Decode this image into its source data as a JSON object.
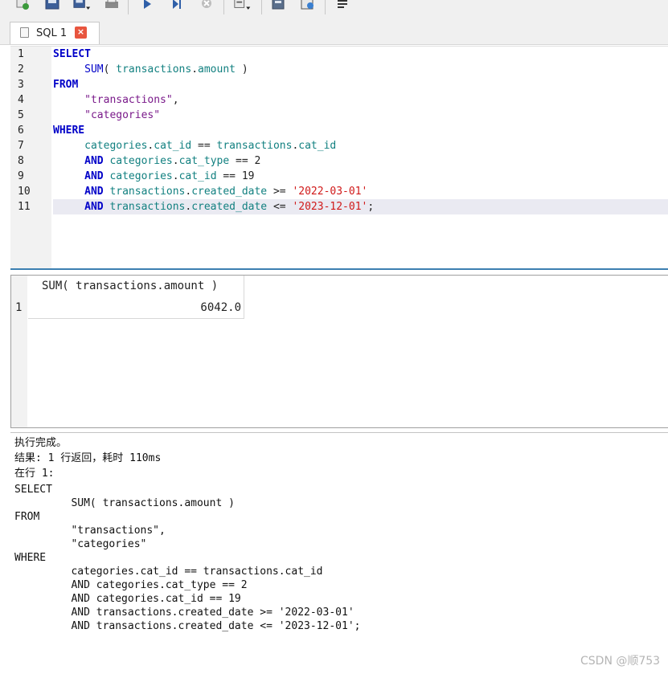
{
  "toolbar": {
    "buttons": [
      "new-query-icon",
      "save-icon",
      "save-as-icon",
      "print-icon",
      "run-icon",
      "run-selection-icon",
      "stop-icon",
      "export-icon",
      "format-icon",
      "explain-icon",
      "text-icon"
    ]
  },
  "tabs": [
    {
      "label": "SQL  1",
      "closable": true
    }
  ],
  "editor": {
    "line_numbers": [
      "1",
      "2",
      "3",
      "4",
      "5",
      "6",
      "7",
      "8",
      "9",
      "10",
      "11"
    ],
    "current_line": 11
  },
  "results": {
    "column_header": "SUM( transactions.amount )",
    "rows": [
      {
        "row_number": "1",
        "value": "6042.0"
      }
    ]
  },
  "messages": {
    "lines": [
      "执行完成。",
      "结果: 1 行返回，耗时 110ms",
      "在行 1:",
      "SELECT",
      "         SUM( transactions.amount )",
      "FROM",
      "         \"transactions\",",
      "         \"categories\"",
      "WHERE",
      "         categories.cat_id == transactions.cat_id",
      "         AND categories.cat_type == 2",
      "         AND categories.cat_id == 19",
      "         AND transactions.created_date >= '2022-03-01'",
      "         AND transactions.created_date <= '2023-12-01';"
    ]
  },
  "watermark": "CSDN @顺753",
  "colors": {
    "keyword": "#0000c8",
    "identifier": "#128080",
    "string": "#7a1a8a",
    "literal": "#d01818",
    "current_line_bg": "#eaeaf2"
  }
}
